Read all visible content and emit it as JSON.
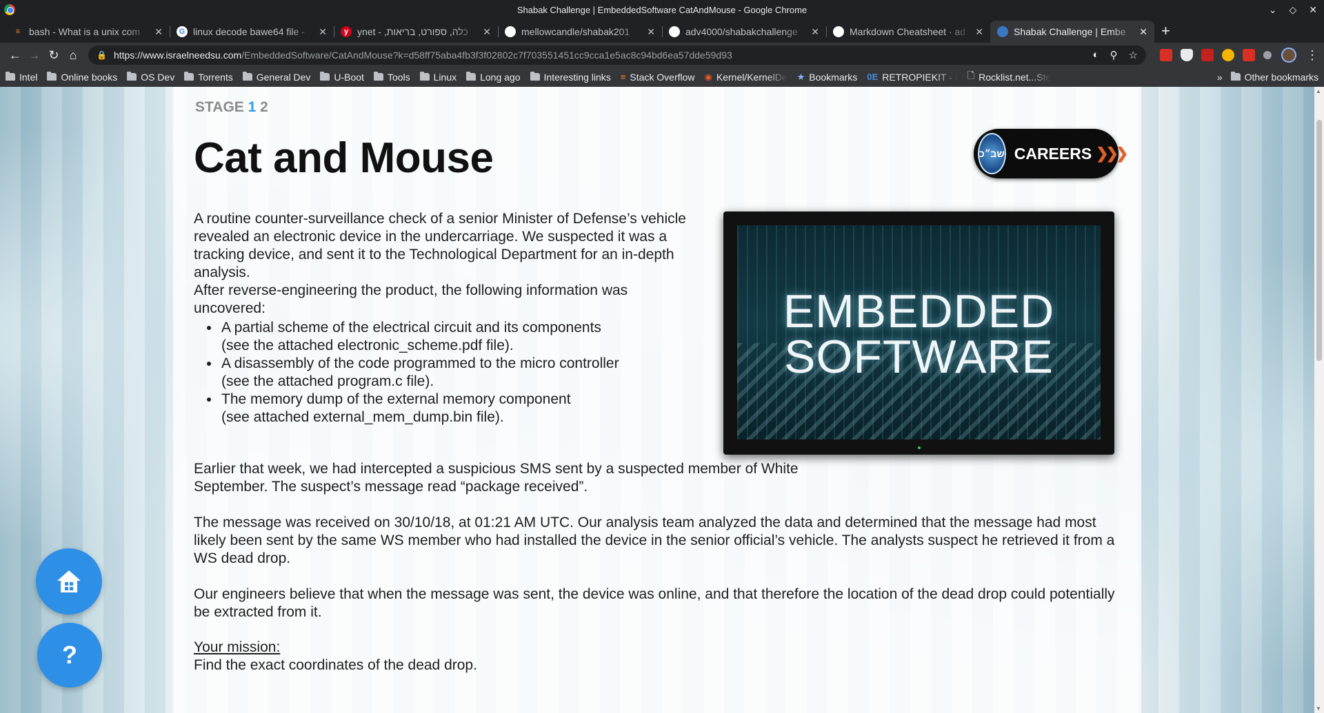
{
  "window": {
    "title": "Shabak Challenge | EmbeddedSoftware CatAndMouse - Google Chrome"
  },
  "tabs": [
    {
      "label": "bash - What is a unix com",
      "icon": "stackoverflow-icon",
      "color": "#f48024"
    },
    {
      "label": "linux decode bawe64 file -",
      "icon": "google-icon",
      "color": "#4285f4"
    },
    {
      "label": "ynet - ,כלה, ספורט, בריאות",
      "icon": "ynet-icon",
      "color": "#d0021b"
    },
    {
      "label": "mellowcandle/shabak201",
      "icon": "github-icon",
      "color": "#ffffff"
    },
    {
      "label": "adv4000/shabakchallenge",
      "icon": "github-icon",
      "color": "#ffffff"
    },
    {
      "label": "Markdown Cheatsheet · ad",
      "icon": "github-icon",
      "color": "#ffffff"
    },
    {
      "label": "Shabak Challenge | Embe",
      "icon": "shabak-icon",
      "color": "#3b78c4",
      "active": true
    }
  ],
  "toolbar": {
    "url_host": "https://www.israelneedsu.com",
    "url_rest": "/EmbeddedSoftware/CatAndMouse?k=d58ff75aba4fb3f3f02802c7f703551451cc9cca1e5ac8c94bd6ea57dde59d93"
  },
  "bookmarks": [
    {
      "label": "Intel",
      "type": "folder"
    },
    {
      "label": "Online books",
      "type": "folder"
    },
    {
      "label": "OS Dev",
      "type": "folder"
    },
    {
      "label": "Torrents",
      "type": "folder"
    },
    {
      "label": "General Dev",
      "type": "folder"
    },
    {
      "label": "U-Boot",
      "type": "folder"
    },
    {
      "label": "Tools",
      "type": "folder"
    },
    {
      "label": "Linux",
      "type": "folder"
    },
    {
      "label": "Long ago",
      "type": "folder"
    },
    {
      "label": "Interesting links",
      "type": "folder"
    },
    {
      "label": "Stack Overflow",
      "type": "link"
    },
    {
      "label": "Kernel/KernelDe",
      "type": "link"
    },
    {
      "label": "Bookmarks",
      "type": "link"
    },
    {
      "label": "RETROPIEKIT - I",
      "type": "link"
    },
    {
      "label": "Rocklist.net...Ste",
      "type": "link"
    }
  ],
  "bookmarks_other": "Other bookmarks",
  "page": {
    "stage_label": "STAGE",
    "stage_current": "1",
    "stage_next": "2",
    "title": "Cat and Mouse",
    "careers_label": "CAREERS",
    "careers_emblem": "שב״כ",
    "image_text_line1": "EMBEDDED",
    "image_text_line2": "SOFTWARE",
    "p1": "A routine counter-surveillance check of a senior Minister of Defense’s vehicle revealed an electronic device in the undercarriage. We suspected it was a tracking device, and sent it to the Technological Department for an in-depth analysis.",
    "p2": "After reverse-engineering the product, the following information was uncovered:",
    "bullets": [
      {
        "line1": "A partial scheme of the electrical circuit and its components",
        "line2": "(see the attached electronic_scheme.pdf file)."
      },
      {
        "line1": "A disassembly of the code programmed to the micro controller",
        "line2": "(see the attached program.c file)."
      },
      {
        "line1": "The memory dump of the external memory component",
        "line2": "(see attached external_mem_dump.bin file)."
      }
    ],
    "p3": "Earlier that week, we had intercepted a suspicious SMS sent by a suspected member of White September. The suspect’s message read “package received”.",
    "p4": "The message was received on 30/10/18, at 01:21 AM UTC. Our analysis team analyzed the data and determined that the message had most likely been sent by the same WS member who had installed the device in the senior official’s vehicle. The analysts suspect he retrieved it from a WS dead drop.",
    "p5": "Our engineers believe that when the message was sent, the device was online, and that therefore the location of the dead drop could potentially be extracted from it.",
    "mission_heading": "Your mission:",
    "mission_text": "Find the exact coordinates of the dead drop.",
    "help_label": "?"
  }
}
